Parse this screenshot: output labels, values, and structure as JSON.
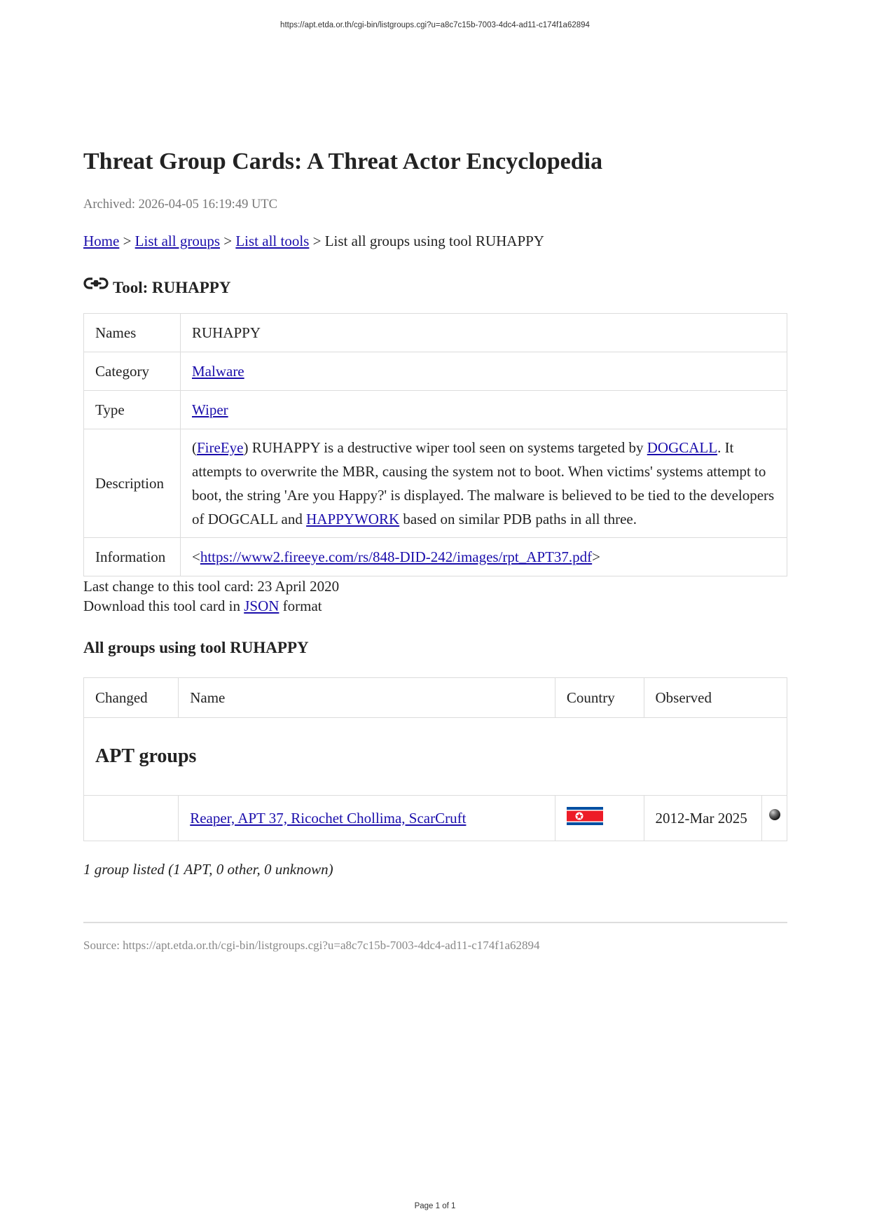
{
  "print_header": "https://apt.etda.or.th/cgi-bin/listgroups.cgi?u=a8c7c15b-7003-4dc4-ad11-c174f1a62894",
  "print_footer": "Page 1 of 1",
  "title": "Threat Group Cards: A Threat Actor Encyclopedia",
  "archived": "Archived: 2026-04-05 16:19:49 UTC",
  "breadcrumb": {
    "home": "Home",
    "sep": ">",
    "groups": "List all groups",
    "tools": "List all tools",
    "current": "List all groups using tool RUHAPPY"
  },
  "tool": {
    "icon": "link-icon",
    "heading": "Tool: RUHAPPY",
    "names_label": "Names",
    "names_value": "RUHAPPY",
    "category_label": "Category",
    "category_value": "Malware",
    "type_label": "Type",
    "type_value": "Wiper",
    "description_label": "Description",
    "description": {
      "open_paren": "(",
      "fireeye": "FireEye",
      "part1": ") RUHAPPY is a destructive wiper tool seen on systems targeted by ",
      "dogcall": "DOGCALL",
      "part2": ". It attempts to overwrite the MBR, causing the system not to boot. When victims' systems attempt to boot, the string 'Are you Happy?' is displayed. The malware is believed to be tied to the developers of DOGCALL and ",
      "happywork": "HAPPYWORK",
      "part3": " based on similar PDB paths in all three."
    },
    "information_label": "Information",
    "information_open": "<",
    "information_link": "https://www2.fireeye.com/rs/848-DID-242/images/rpt_APT37.pdf",
    "information_close": ">"
  },
  "last_change": "Last change to this tool card: 23 April 2020",
  "download": {
    "before": "Download this tool card in ",
    "link": "JSON",
    "after": " format"
  },
  "groups_heading": "All groups using tool RUHAPPY",
  "groups_table": {
    "headers": {
      "changed": "Changed",
      "name": "Name",
      "country": "Country",
      "observed": "Observed"
    },
    "section": "APT groups",
    "rows": [
      {
        "changed": "",
        "name": "Reaper, APT 37, Ricochet Chollima, ScarCruft",
        "country_icon": "north-korea-flag-icon",
        "observed": "2012-Mar 2025",
        "status_icon": "black-dot-icon"
      }
    ]
  },
  "summary": "1 group listed (1 APT, 0 other, 0 unknown)",
  "source": "Source: https://apt.etda.or.th/cgi-bin/listgroups.cgi?u=a8c7c15b-7003-4dc4-ad11-c174f1a62894",
  "colors": {
    "link": "#1a0dab",
    "muted": "#777777",
    "border": "#dcdcdc"
  }
}
